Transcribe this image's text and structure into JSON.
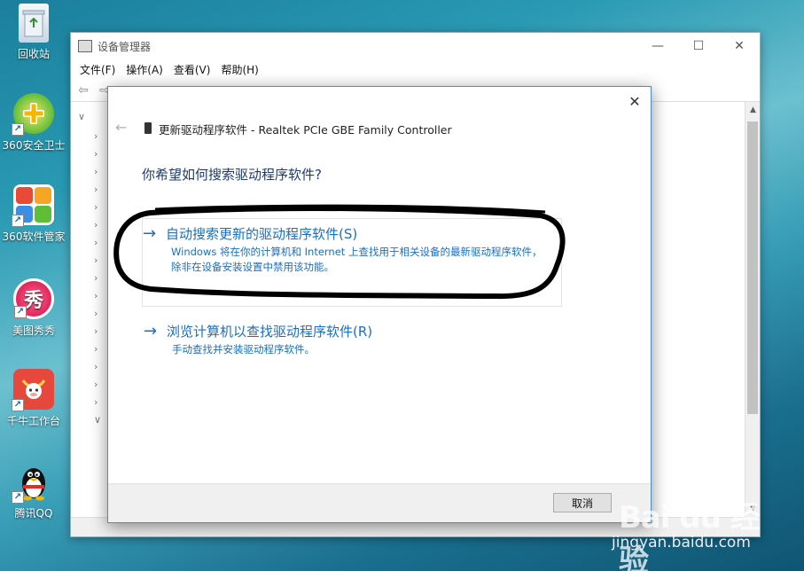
{
  "desktop": {
    "icons": [
      {
        "label": "回收站",
        "icon": "recycle-bin-icon",
        "color": "#dfe9f3"
      },
      {
        "label": "360安全卫士",
        "icon": "360-security-icon",
        "color": "#53b72c"
      },
      {
        "label": "360软件管家",
        "icon": "360-software-manager-icon",
        "color": "#e94a35"
      },
      {
        "label": "美图秀秀",
        "icon": "meitu-icon",
        "color": "#e0245e"
      },
      {
        "label": "千牛工作台",
        "icon": "qianniu-icon",
        "color": "#e8483b"
      },
      {
        "label": "腾讯QQ",
        "icon": "qq-penguin-icon",
        "color": "#111111"
      }
    ]
  },
  "device_manager": {
    "title": "设备管理器",
    "menu": [
      "文件(F)",
      "操作(A)",
      "查看(V)",
      "帮助(H)"
    ],
    "controls": {
      "minimize": "—",
      "maximize": "☐",
      "close": "✕"
    }
  },
  "dialog": {
    "title": "更新驱动程序软件 - Realtek PCIe GBE Family Controller",
    "question": "你希望如何搜索驱动程序软件?",
    "option_auto": {
      "title": "自动搜索更新的驱动程序软件(S)",
      "description": "Windows 将在你的计算机和 Internet 上查找用于相关设备的最新驱动程序软件，除非在设备安装设置中禁用该功能。"
    },
    "option_browse": {
      "title": "浏览计算机以查找驱动程序软件(R)",
      "description": "手动查找并安装驱动程序软件。"
    },
    "cancel_label": "取消",
    "accent_color": "#1a6fc4"
  },
  "watermark": {
    "logo": "Bai du 经验",
    "url": "jingyan.baidu.com"
  }
}
